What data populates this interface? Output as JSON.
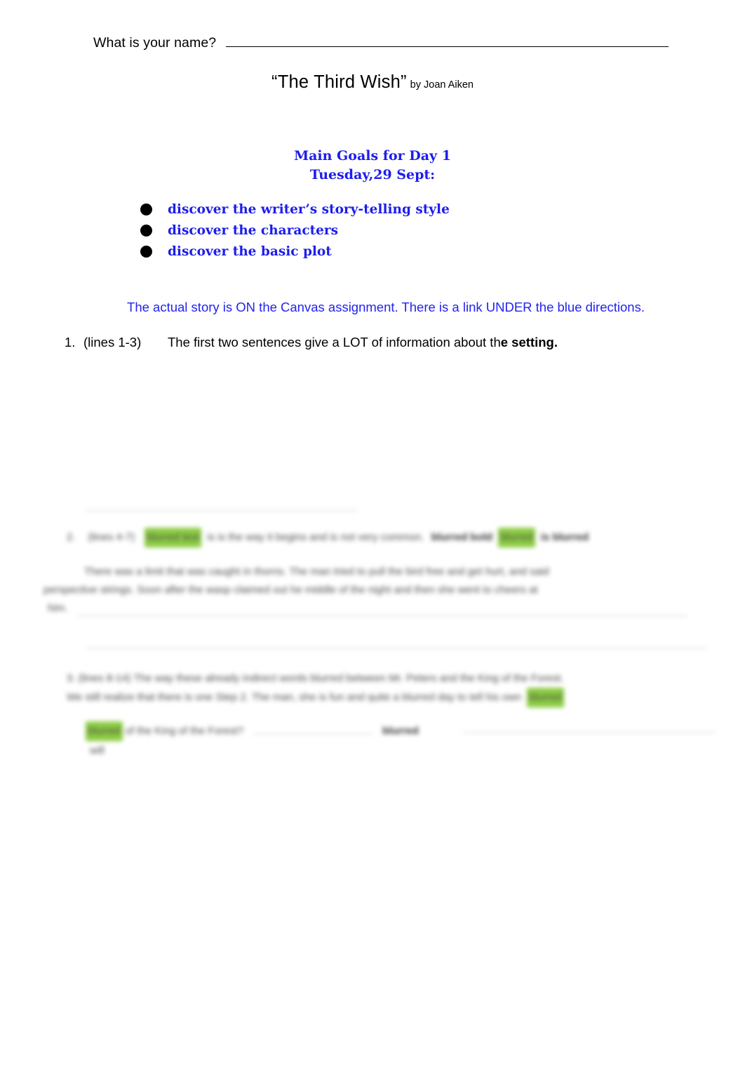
{
  "document": {
    "name_prompt": "What is your name?",
    "title": "“The Third Wish”",
    "byline": "by Joan Aiken"
  },
  "goals": {
    "heading_line1": "Main Goals for Day 1",
    "heading_line2": "Tuesday,29 Sept:",
    "items": [
      {
        "label": "discover the writer’s story-telling style"
      },
      {
        "label": "discover the characters"
      },
      {
        "label": "discover the basic plot"
      }
    ],
    "color": "#1d1ded"
  },
  "notes": {
    "canvas_note": "The actual story is ON the Canvas assignment. There is a link UNDER the blue directions.",
    "canvas_note_color": "#2323f0"
  },
  "questions": [
    {
      "number": "1.",
      "lines": "(lines 1-3)",
      "text_plain": "The first two sentences give a LOT of information about th",
      "text_bold": "e setting."
    }
  ],
  "redacted": {
    "note": "blurred-unreadable",
    "highlight_color": "#8ccc42",
    "block1": {
      "line1_pre": "2.",
      "line1_a": "(lines 4-7)",
      "line1_hl1": "blurred text",
      "line1_b": "is is the way it begins and is not very common.",
      "line1_bold": "blurred bold",
      "line1_hl2": "blurred",
      "line1_c": "is blurred",
      "line2": "There was a limit that was caught in thorns. The man tried to pull the bird free and get hurt, and said",
      "line3": "perspective strings. Soon after the wasp claimed out he middle of the night and then she went to cheers at",
      "line4": "him."
    },
    "block2": {
      "line1": "3.    (lines 8-14)   The way these already indirect words blurred between Mr. Peters and the King of the Forest.",
      "line2": "We still realize that there is one Step 2.   The man, she is fun and quite a blurred day to tell his own",
      "line2_hl": "blurred",
      "line3_hl": "blurred",
      "line3": "of the King of the Forest?",
      "line3_tail": "blurred",
      "line4": "will"
    }
  }
}
